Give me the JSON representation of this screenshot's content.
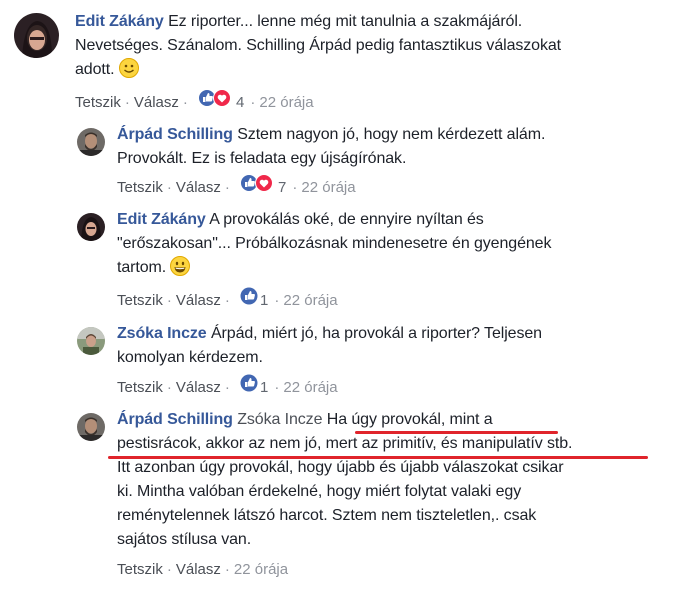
{
  "actions": {
    "like": "Tetszik",
    "reply": "Válasz",
    "sep": "·"
  },
  "colors": {
    "link": "#365899",
    "text": "#1d2129",
    "meta": "#90949c",
    "underline": "#e0242b",
    "like_blue": "#4267b2",
    "love_red": "#f0284a"
  },
  "comments": [
    {
      "author": "Edit Zákány",
      "lines": [
        "Ez riporter... lenne még mit tanulnia a szakmájáról.",
        "Nevetséges. Szánalom. Schilling Árpád pedig fantasztikus válaszokat",
        "adott."
      ],
      "emoji": "slightly-smiling-face",
      "reactions": [
        "like",
        "love"
      ],
      "count": "4",
      "time": "22 órája"
    },
    {
      "author": "Árpád Schilling",
      "lines": [
        "Sztem nagyon jó, hogy nem kérdezett alám.",
        "Provokált. Ez is feladata egy újságírónak."
      ],
      "reactions": [
        "like",
        "love"
      ],
      "count": "7",
      "time": "22 órája"
    },
    {
      "author": "Edit Zákány",
      "lines": [
        "A provokálás oké, de ennyire nyíltan és",
        "\"erőszakosan\"... Próbálkozásnak mindenesetre én gyengének",
        "tartom."
      ],
      "emoji": "grinning-face",
      "reactions": [
        "like"
      ],
      "count": "1",
      "time": "22 órája"
    },
    {
      "author": "Zsóka Incze",
      "lines": [
        "Árpád, miért jó, ha provokál a riporter? Teljesen",
        "komolyan kérdezem."
      ],
      "reactions": [
        "like"
      ],
      "count": "1",
      "time": "22 órája"
    },
    {
      "author": "Árpád Schilling",
      "mention": "Zsóka Incze",
      "lines": [
        "Ha úgy provokál, mint a",
        "pestisrácok, akkor az nem jó, mert az primitív, és manipulatív stb.",
        "Itt azonban úgy provokál, hogy újabb és újabb válaszokat csikar",
        "ki. Mintha valóban érdekelné, hogy miért folytat valaki egy",
        "reménytelennek látszó harcot. Sztem nem tiszteletlen,. csak",
        "sajátos stílusa van."
      ],
      "time": "22 órája"
    }
  ]
}
